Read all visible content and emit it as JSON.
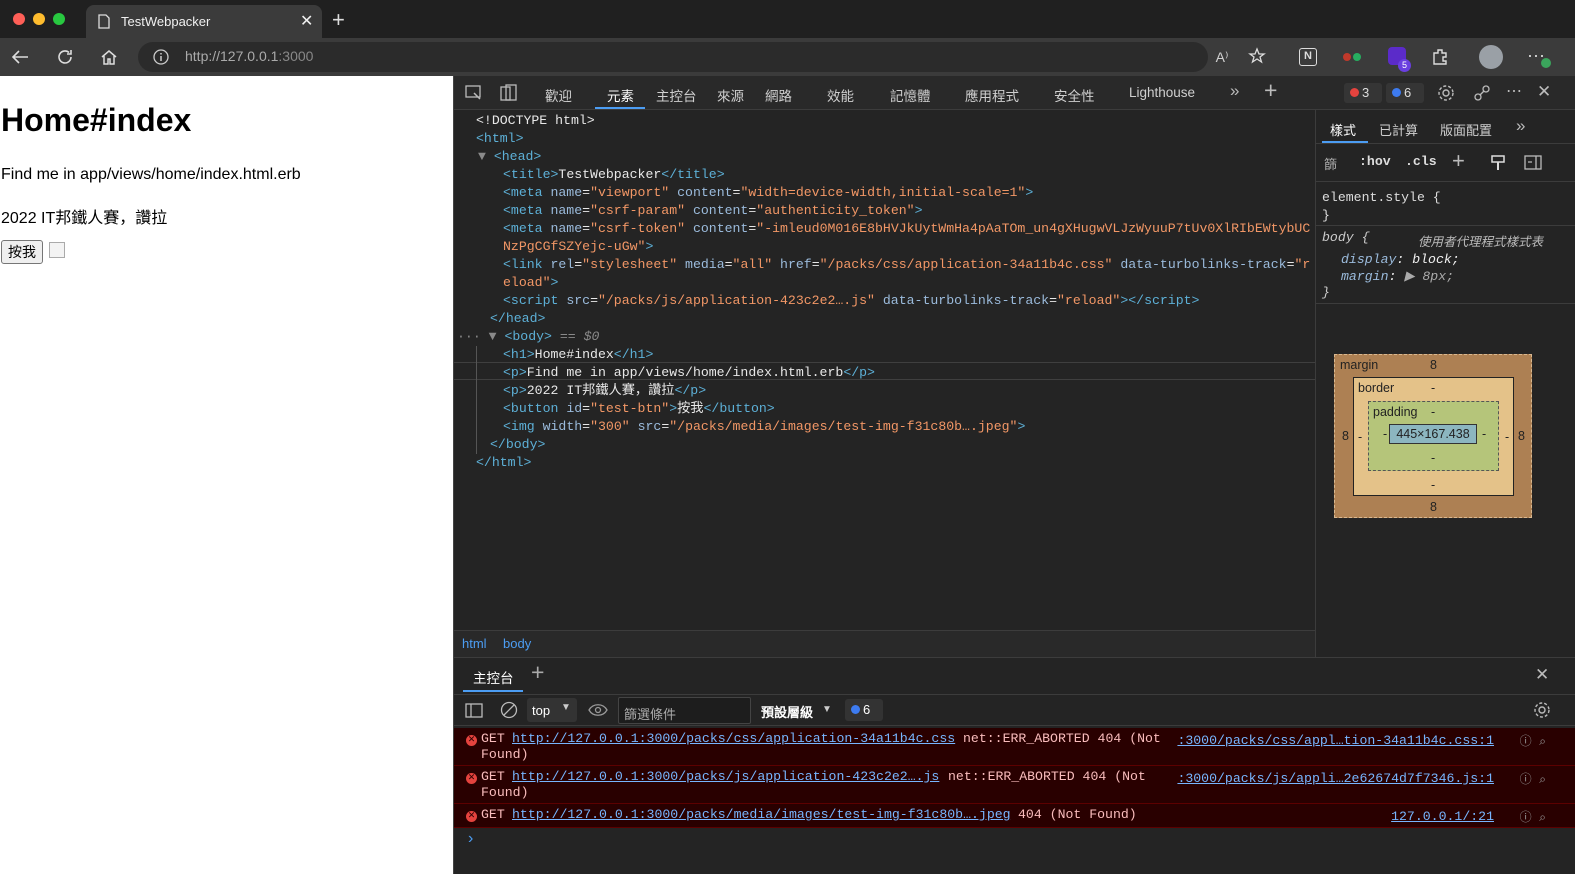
{
  "browser": {
    "tab_title": "TestWebpacker",
    "new_tab": "+",
    "url_host": "http://127.0.0.1",
    "url_port": ":3000"
  },
  "page": {
    "h1": "Home#index",
    "p1": "Find me in app/views/home/index.html.erb",
    "p2": "2022 IT邦鐵人賽，讚拉",
    "button": "按我"
  },
  "devtools": {
    "tabs": [
      "歡迎",
      "元素",
      "主控台",
      "來源",
      "網路",
      "效能",
      "記憶體",
      "應用程式",
      "安全性",
      "Lighthouse"
    ],
    "error_count": "3",
    "message_count": "6",
    "extensions_badge": "5",
    "elements": {
      "doctype": "<!DOCTYPE html>",
      "title_text": "TestWebpacker",
      "viewport_content": "\"width=device-width,initial-scale=1\"",
      "csrf_param_content": "\"authenticity_token\"",
      "csrf_token_line1": "\"-imleud0M016E8bHVJkUytWmHa4pAaTOm_un4gXHugwVLJzWyuuP7tUv0XlRIbEWtybUC",
      "csrf_token_line2": "NzPgCGfSZYejc-uGw\"",
      "stylesheet_href": "\"/packs/css/application-34a11b4c.css\"",
      "turbolinks_track_1": "\"r",
      "turbolinks_track_2": "eload\"",
      "script_src": "\"/packs/js/application-423c2e2….js\"",
      "turbolinks_reload": "\"reload\"",
      "dollar0": "== $0",
      "h1_text": "Home#index",
      "p1_text": "Find me in app/views/home/index.html.erb",
      "p2_text": "2022 IT邦鐵人賽，讚拉",
      "btn_id": "\"test-btn\"",
      "btn_text": "按我",
      "img_width": "\"300\"",
      "img_src": "\"/packs/media/images/test-img-f31c80b….jpeg\""
    },
    "breadcrumbs": [
      "html",
      "body"
    ],
    "styles": {
      "tabs": [
        "樣式",
        "已計算",
        "版面配置"
      ],
      "filter_label": "篩",
      "hov": ":hov",
      "cls": ".cls",
      "element_style": "element.style {",
      "close_brace": "}",
      "body_selector": "body {",
      "ua_label": "使用者代理程式樣式表",
      "display_prop": "display",
      "display_val": "block;",
      "margin_prop": "margin",
      "margin_val": "8px;",
      "box": {
        "margin_label": "margin",
        "margin_val": "8",
        "border_label": "border",
        "padding_label": "padding",
        "dash": "-",
        "content": "445×167.438"
      }
    },
    "console": {
      "drawer_tab": "主控台",
      "context": "top",
      "filter_placeholder": "篩選條件",
      "levels": "預設層級",
      "msg_count": "6",
      "errors": [
        {
          "method": "GET",
          "url": "http://127.0.0.1:3000/packs/css/application-34a11b4c.css",
          "status": "net::ERR_ABORTED 404 (Not",
          "status2": "Found)",
          "source": ":3000/packs/css/appl…tion-34a11b4c.css:1"
        },
        {
          "method": "GET",
          "url": "http://127.0.0.1:3000/packs/js/application-423c2e2….js",
          "status": "net::ERR_ABORTED 404 (Not",
          "status2": "Found)",
          "source": ":3000/packs/js/appli…2e62674d7f7346.js:1"
        },
        {
          "method": "GET",
          "url": "http://127.0.0.1:3000/packs/media/images/test-img-f31c80b….jpeg",
          "status": "404 (Not Found)",
          "status2": "",
          "source": "127.0.0.1/:21"
        }
      ],
      "prompt": "›"
    }
  },
  "colors": {
    "accent": "#4c9df3",
    "error_bg": "#290000",
    "tag": "#5db0d7",
    "attr_value": "#f29766"
  }
}
